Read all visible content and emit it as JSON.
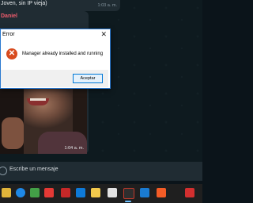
{
  "chat": {
    "top_message": "Joven, sin IP vieja)",
    "top_time": "1:03 a. m.",
    "sender": "Daniel",
    "image_time": "1:04 a. m."
  },
  "dialog": {
    "title": "Error",
    "close_glyph": "✕",
    "message": "Manager already installed and running",
    "icon_glyph": "✕",
    "ok_label": "Aceptar"
  },
  "composer": {
    "placeholder": "Escribe un mensaje"
  },
  "taskbar": {
    "icons": [
      "file-explorer-icon",
      "edge-icon",
      "store-icon",
      "mail-icon",
      "media-icon",
      "vscode-icon",
      "folder-icon",
      "app-icon",
      "ide-icon",
      "spotify-icon",
      "brave-icon",
      "app2-icon"
    ],
    "accent": "#6cc0ff"
  },
  "colors": {
    "sender_color": "#f15c6d",
    "error_icon": "#d84b1e",
    "dialog_border": "#2b79d0"
  }
}
